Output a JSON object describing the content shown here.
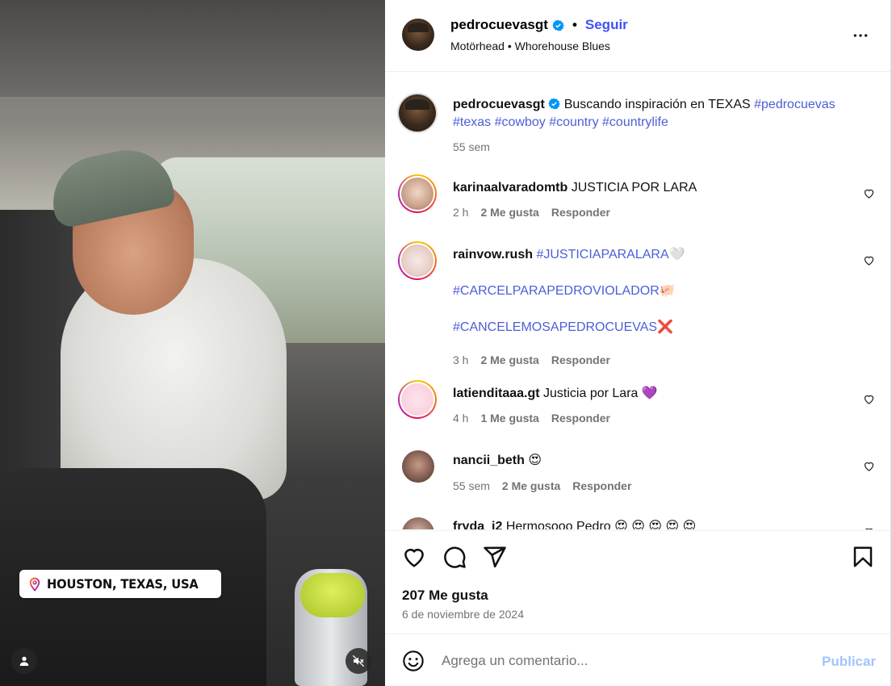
{
  "post": {
    "location_sticker": "HOUSTON, TEXAS, USA",
    "author": {
      "username": "pedrocuevasgt",
      "verified": true,
      "follow_label": "Seguir",
      "music": "Motörhead • Whorehouse Blues"
    },
    "caption": {
      "username": "pedrocuevasgt",
      "text": "Buscando inspiración en TEXAS",
      "hashtags_line1": "#pedrocuevas",
      "hashtags_line2": [
        "#texas",
        "#cowboy",
        "#country",
        "#countrylife"
      ],
      "time": "55 sem"
    },
    "likes": "207 Me gusta",
    "date": "6 de noviembre de 2024"
  },
  "comments": [
    {
      "username": "karinaalvaradomtb",
      "text": "JUSTICIA POR LARA",
      "time": "2 h",
      "likes": "2 Me gusta",
      "reply": "Responder"
    },
    {
      "username": "rainvow.rush",
      "line1": "#JUSTICIAPARALARA",
      "line1_emoji": "🤍",
      "line2": "#CARCELPARAPEDROVIOLADOR",
      "line2_emoji": "🐖",
      "line3": "#CANCELEMOSAPEDROCUEVAS",
      "line3_emoji": "❌",
      "time": "3 h",
      "likes": "2 Me gusta",
      "reply": "Responder"
    },
    {
      "username": "latienditaaa.gt",
      "text": "Justicia por Lara",
      "emoji": "💜",
      "time": "4 h",
      "likes": "1 Me gusta",
      "reply": "Responder"
    },
    {
      "username": "nancii_beth",
      "text": "",
      "emoji": "😍",
      "time": "55 sem",
      "likes": "2 Me gusta",
      "reply": "Responder"
    },
    {
      "username": "fryda_i2",
      "text": "Hermosooo Pedro",
      "emoji": "😍 😍 😍 😍 😍"
    }
  ],
  "composer": {
    "placeholder": "Agrega un comentario...",
    "publish_label": "Publicar"
  },
  "icons": {
    "more": "more-horizontal-icon",
    "like": "heart-icon",
    "comment": "comment-icon",
    "share": "share-icon",
    "save": "bookmark-icon",
    "emoji": "emoji-icon",
    "location": "location-pin-icon",
    "tagged_user": "user-icon",
    "mute": "mute-icon"
  },
  "colors": {
    "link": "#4150f7",
    "hashtag": "#4c5fd5",
    "secondary_text": "#737373",
    "publish_disabled": "#a3c4fb",
    "verified": "#0095f6"
  }
}
